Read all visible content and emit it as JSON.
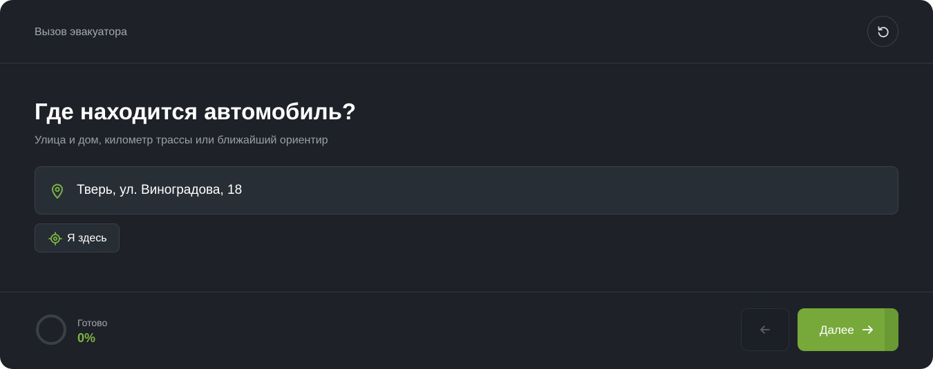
{
  "header": {
    "title": "Вызов эвакуатора",
    "reset_icon": "reset-icon"
  },
  "main": {
    "question": "Где находится автомобиль?",
    "hint": "Улица и дом, километр трассы или ближайший ориентир",
    "address": {
      "value": "Тверь, ул. Виноградова, 18",
      "icon": "map-pin-icon"
    },
    "locate_button": {
      "label": "Я здесь",
      "icon": "target-icon"
    }
  },
  "footer": {
    "progress_label": "Готово",
    "progress_value": "0%",
    "progress_fraction": 0,
    "back_icon": "arrow-left-icon",
    "next_label": "Далее",
    "next_icon": "arrow-right-icon"
  },
  "colors": {
    "background": "#1e2228",
    "accent": "#76a83a",
    "accent_text": "#7cb342",
    "field_bg": "#282e35"
  }
}
